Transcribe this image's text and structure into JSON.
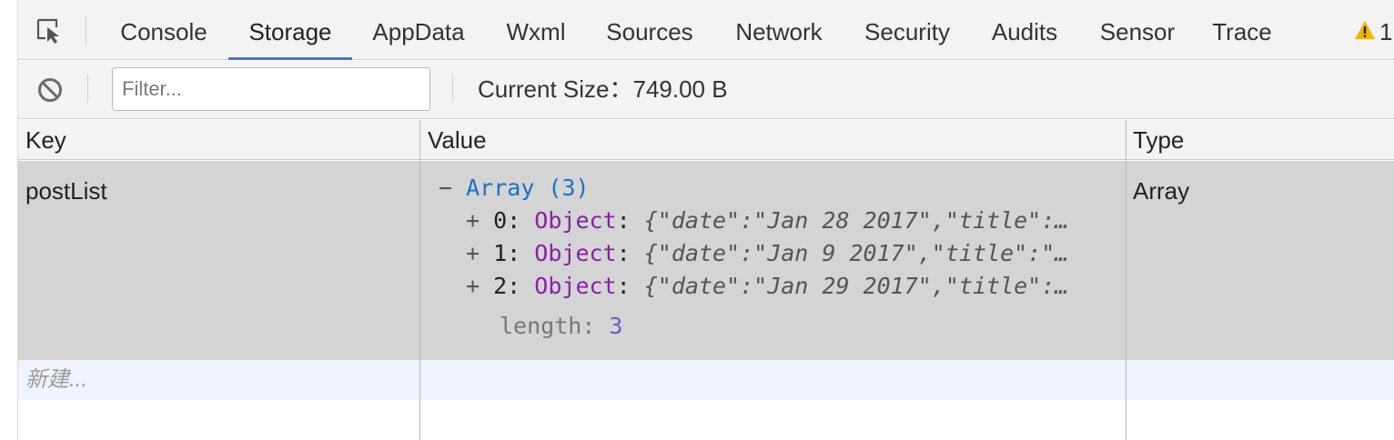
{
  "tabs": [
    {
      "label": "Console"
    },
    {
      "label": "Storage"
    },
    {
      "label": "AppData"
    },
    {
      "label": "Wxml"
    },
    {
      "label": "Sources"
    },
    {
      "label": "Network"
    },
    {
      "label": "Security"
    },
    {
      "label": "Audits"
    },
    {
      "label": "Sensor"
    },
    {
      "label": "Trace"
    }
  ],
  "active_tab": "Storage",
  "warnings": {
    "count": "1",
    "color": "#f4b400"
  },
  "toolbar": {
    "filter_placeholder": "Filter...",
    "current_size": "Current Size：749.00 B"
  },
  "table": {
    "headers": {
      "key": "Key",
      "value": "Value",
      "type": "Type"
    },
    "row": {
      "key": "postList",
      "type": "Array",
      "value": {
        "toggle": "−",
        "summary": "Array (3)",
        "items": [
          {
            "toggle": "+",
            "index": "0:",
            "kind": "Object",
            "colon": ":",
            "preview": "{\"date\":\"Jan 28 2017\",\"title\":…"
          },
          {
            "toggle": "+",
            "index": "1:",
            "kind": "Object",
            "colon": ":",
            "preview": "{\"date\":\"Jan 9 2017\",\"title\":\"…"
          },
          {
            "toggle": "+",
            "index": "2:",
            "kind": "Object",
            "colon": ":",
            "preview": "{\"date\":\"Jan 29 2017\",\"title\":…"
          }
        ],
        "length_key": "length:",
        "length_value": "3"
      }
    },
    "new_placeholder": "新建..."
  },
  "colors": {
    "accent": "#3a7bd5",
    "row_bg": "#d4d4d4",
    "new_row_bg": "#eef3fc"
  }
}
